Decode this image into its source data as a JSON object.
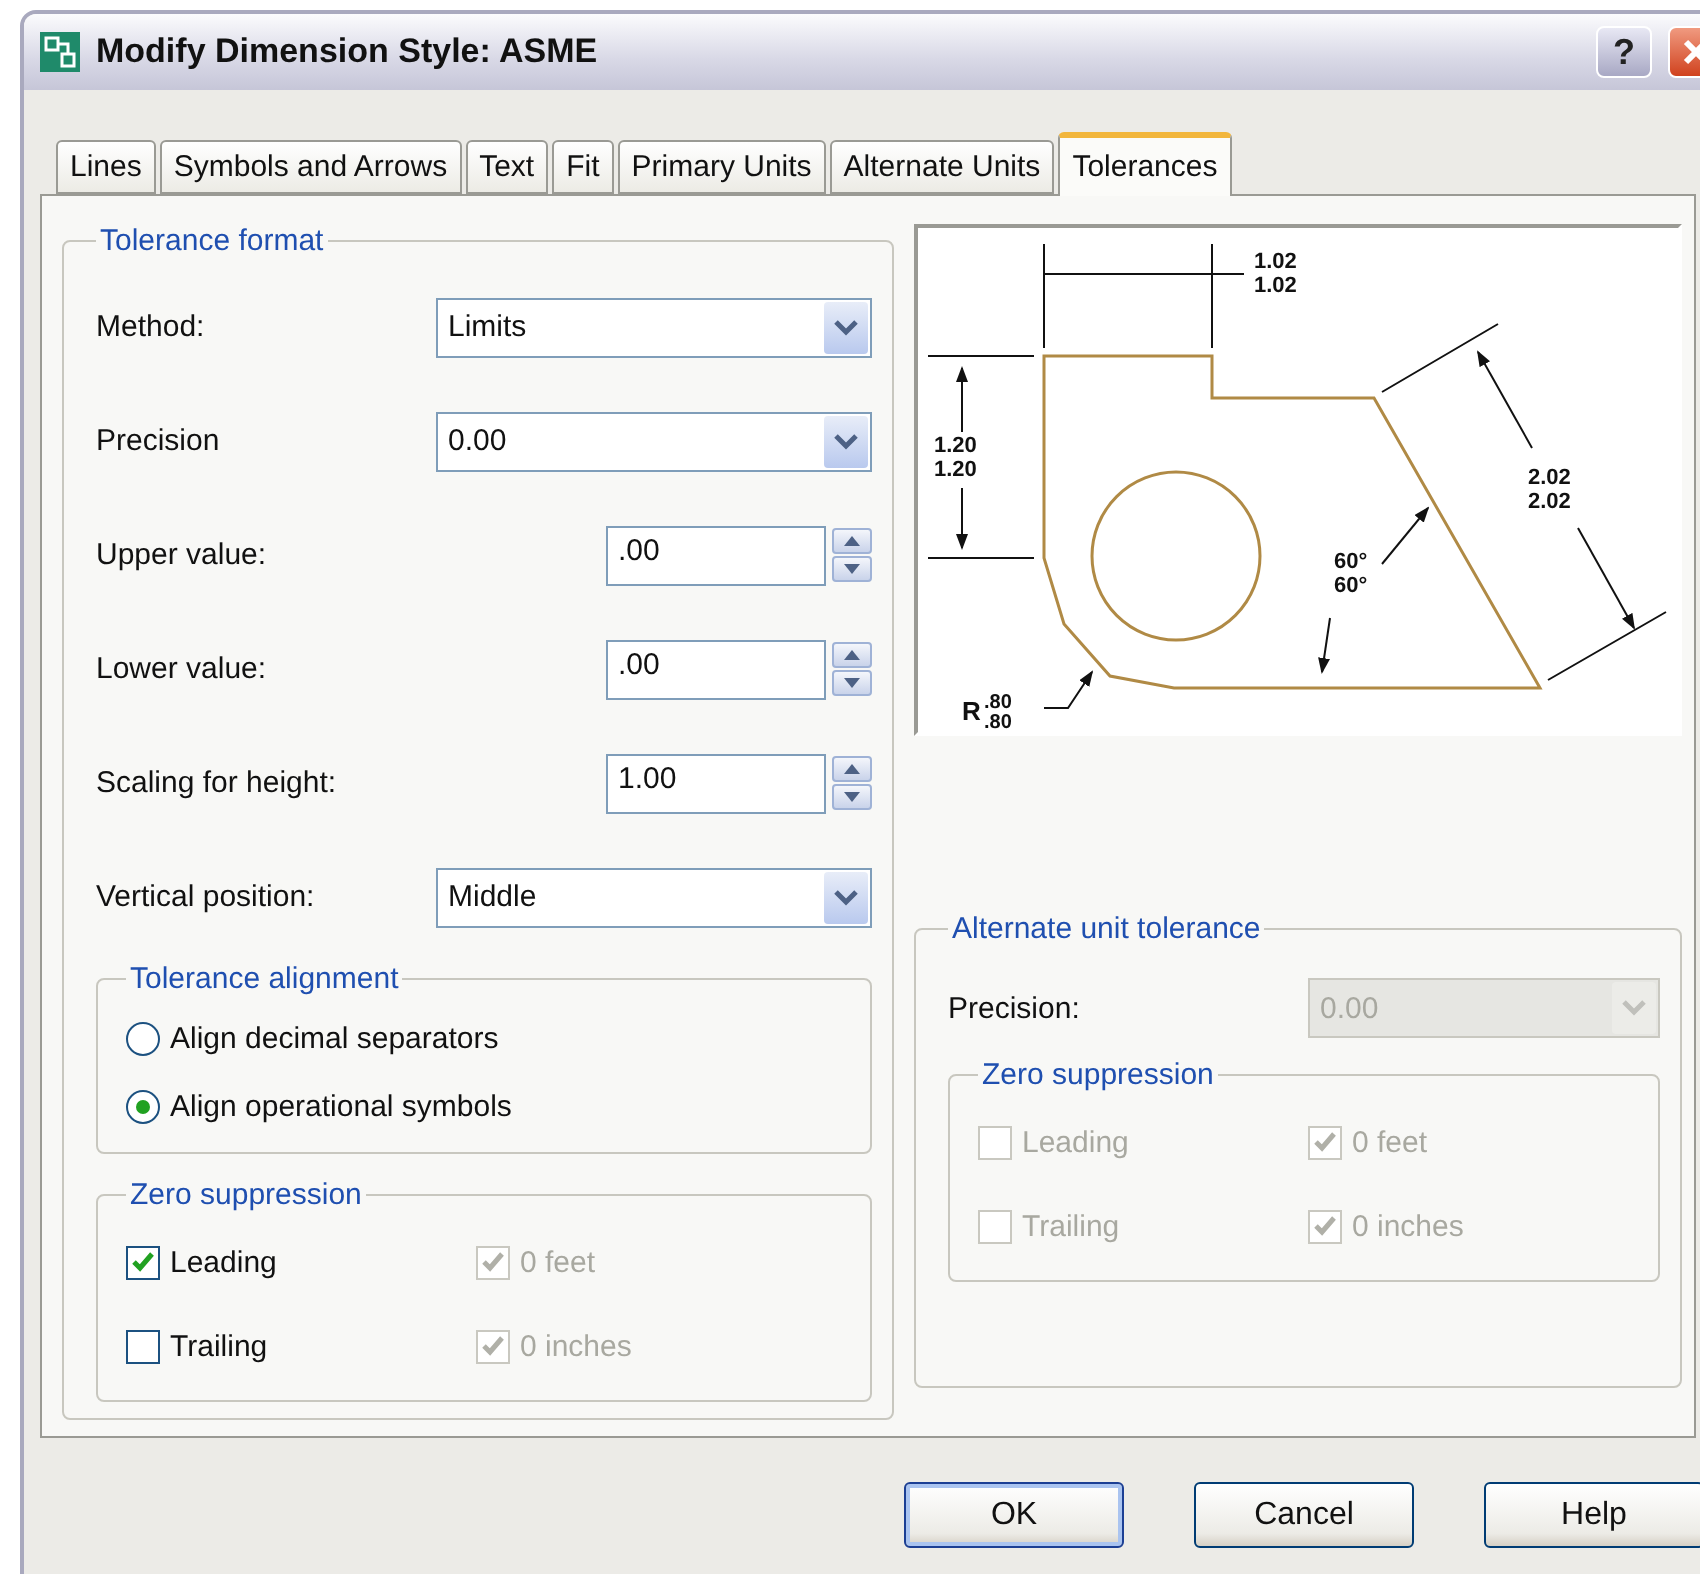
{
  "window": {
    "title": "Modify Dimension Style: ASME",
    "help_button": "?"
  },
  "tabs": [
    {
      "label": "Lines",
      "selected": false
    },
    {
      "label": "Symbols and Arrows",
      "selected": false
    },
    {
      "label": "Text",
      "selected": false
    },
    {
      "label": "Fit",
      "selected": false
    },
    {
      "label": "Primary Units",
      "selected": false
    },
    {
      "label": "Alternate Units",
      "selected": false
    },
    {
      "label": "Tolerances",
      "selected": true
    }
  ],
  "tolerance_format": {
    "legend": "Tolerance format",
    "fields": [
      {
        "kind": "select",
        "label": "Method:",
        "value": "Limits"
      },
      {
        "kind": "select",
        "label": "Precision",
        "value": "0.00"
      },
      {
        "kind": "spinner",
        "label": "Upper value:",
        "value": ".00"
      },
      {
        "kind": "spinner",
        "label": "Lower value:",
        "value": ".00"
      },
      {
        "kind": "spinner",
        "label": "Scaling for height:",
        "value": "1.00"
      },
      {
        "kind": "select",
        "label": "Vertical position:",
        "value": "Middle"
      }
    ],
    "alignment": {
      "legend": "Tolerance alignment",
      "options": [
        {
          "label": "Align decimal separators",
          "selected": false
        },
        {
          "label": "Align operational symbols",
          "selected": true
        }
      ]
    },
    "zero_suppression": {
      "legend": "Zero suppression",
      "items": [
        {
          "label": "Leading",
          "checked": true,
          "disabled": false
        },
        {
          "label": "0 feet",
          "checked": true,
          "disabled": true
        },
        {
          "label": "Trailing",
          "checked": false,
          "disabled": false
        },
        {
          "label": "0 inches",
          "checked": true,
          "disabled": true
        }
      ]
    }
  },
  "preview": {
    "width_upper": "1.02",
    "width_lower": "1.02",
    "height_upper": "1.20",
    "height_lower": "1.20",
    "slant_upper": "2.02",
    "slant_lower": "2.02",
    "angle_upper": "60°",
    "angle_lower": "60°",
    "radius_symbol": "R",
    "radius_upper": ".80",
    "radius_lower": ".80"
  },
  "alternate_unit_tolerance": {
    "legend": "Alternate unit tolerance",
    "precision": {
      "label": "Precision:",
      "value": "0.00",
      "disabled": true
    },
    "zero_suppression": {
      "legend": "Zero suppression",
      "items": [
        {
          "label": "Leading",
          "checked": false,
          "disabled": true
        },
        {
          "label": "0 feet",
          "checked": true,
          "disabled": true
        },
        {
          "label": "Trailing",
          "checked": false,
          "disabled": true
        },
        {
          "label": "0 inches",
          "checked": true,
          "disabled": true
        }
      ]
    }
  },
  "buttons": [
    "OK",
    "Cancel",
    "Help"
  ]
}
